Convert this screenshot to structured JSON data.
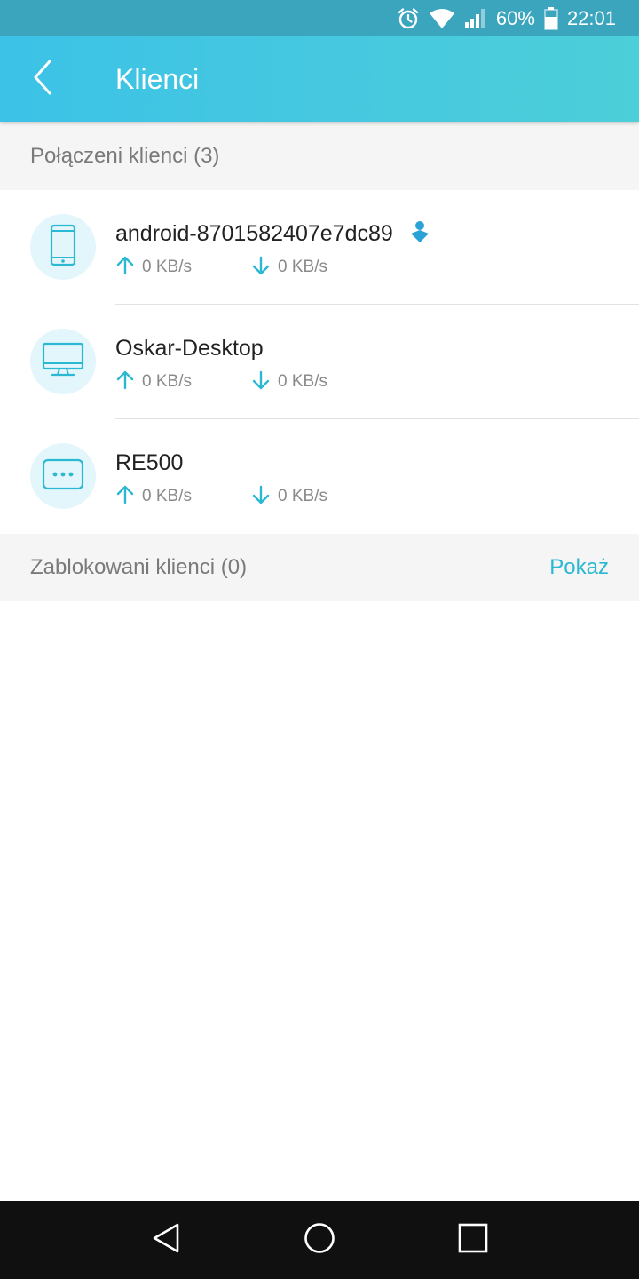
{
  "status_bar": {
    "battery_percent": "60%",
    "time": "22:01",
    "icons": [
      "alarm-icon",
      "wifi-icon",
      "signal-icon",
      "battery-icon"
    ]
  },
  "app_bar": {
    "title": "Klienci",
    "back_icon": "chevron-left-icon"
  },
  "connected": {
    "title": "Połączeni klienci (3)",
    "clients": [
      {
        "name": "android-8701582407e7dc89",
        "icon": "smartphone-icon",
        "upload": "0 KB/s",
        "download": "0 KB/s",
        "current_user_badge": "user-badge-icon"
      },
      {
        "name": "Oskar-Desktop",
        "icon": "monitor-icon",
        "upload": "0 KB/s",
        "download": "0 KB/s"
      },
      {
        "name": "RE500",
        "icon": "other-device-icon",
        "upload": "0 KB/s",
        "download": "0 KB/s"
      }
    ]
  },
  "blocked": {
    "title": "Zablokowani klienci (0)",
    "show_label": "Pokaż"
  },
  "colors": {
    "accent": "#2bb8d2",
    "status_bar": "#3aa5bd",
    "app_bar_start": "#3bc2e6",
    "app_bar_end": "#4ccfd8",
    "avatar_bg": "#e3f6fb",
    "section_bg": "#f5f5f5"
  }
}
